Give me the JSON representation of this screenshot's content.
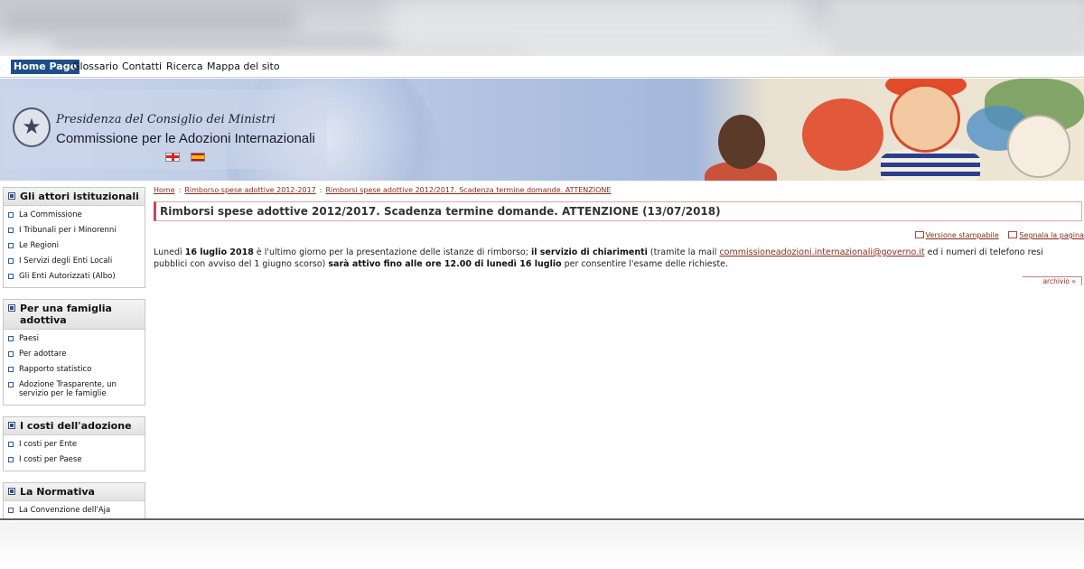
{
  "topnav": {
    "items": [
      "Home Page",
      "Glossario",
      "Contatti",
      "Ricerca",
      "Mappa del sito"
    ]
  },
  "header": {
    "org_line1": "Presidenza del Consiglio dei Ministri",
    "org_line2": "Commissione per le Adozioni Internazionali",
    "languages": [
      "English",
      "Español"
    ]
  },
  "sidebar": {
    "sections": [
      {
        "title": "Gli attori istituzionali",
        "items": [
          "La Commissione",
          "I Tribunali per i Minorenni",
          "Le Regioni",
          "I Servizi degli Enti Locali",
          "Gli Enti Autorizzati (Albo)"
        ]
      },
      {
        "title": "Per una famiglia adottiva",
        "items": [
          "Paesi",
          "Per adottare",
          "Rapporto statistico",
          "Adozione Trasparente, un servizio per le famiglie"
        ]
      },
      {
        "title": "I costi dell'adozione",
        "items": [
          "I costi per Ente",
          "I costi per Paese"
        ]
      },
      {
        "title": "La Normativa",
        "items": [
          "La Convenzione dell'Aja"
        ]
      }
    ]
  },
  "breadcrumb": [
    "Home",
    "Rimborso spese adottive 2012-2017",
    "Rimborsi spese adottive 2012/2017. Scadenza termine domande. ATTENZIONE"
  ],
  "main": {
    "title": "Rimborsi spese adottive 2012/2017. Scadenza termine domande. ATTENZIONE (13/07/2018)",
    "print_link": "Versione stampabile",
    "share_link": "Segnala la pagina",
    "p1_a": "Lunedì ",
    "p1_b": "16 luglio 2018",
    "p1_c": " è l'ultimo giorno per la presentazione delle istanze di rimborso; ",
    "p1_d": "il servizio di chiarimenti",
    "p1_e": " (tramite la mail ",
    "p1_mail": "commissioneadozioni.internazionali@governo.it",
    "p1_f": " ed i numeri di telefono resi",
    "p2_a": "pubblici con avviso del 1 giugno scorso) ",
    "p2_b": "sarà attivo fino alle ore 12.00 di lunedì 16 luglio",
    "p2_c": " per consentire l'esame delle richieste.",
    "archive": "archivio »"
  },
  "colors": {
    "accent": "#1f4f87",
    "link": "#8a2a1a",
    "title_border": "#c24a5a"
  }
}
